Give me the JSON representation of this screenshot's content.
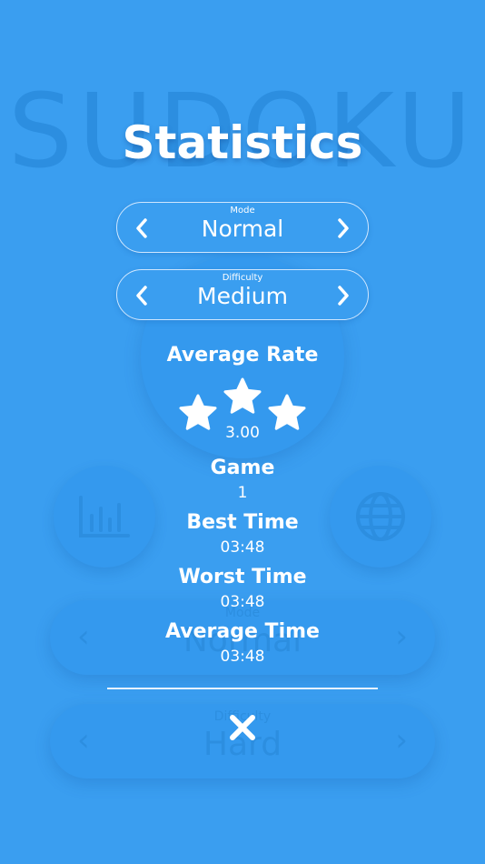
{
  "background": {
    "title": "SUDOKU",
    "mode_caption": "Mode",
    "mode_value": "Normal",
    "difficulty_caption": "Difficulty",
    "difficulty_value": "Hard"
  },
  "statistics": {
    "title": "Statistics",
    "mode": {
      "caption": "Mode",
      "value": "Normal"
    },
    "difficulty": {
      "caption": "Difficulty",
      "value": "Medium"
    },
    "average_rate": {
      "label": "Average Rate",
      "value": "3.00",
      "stars": 3
    },
    "game": {
      "label": "Game",
      "value": "1"
    },
    "best_time": {
      "label": "Best Time",
      "value": "03:48"
    },
    "worst_time": {
      "label": "Worst Time",
      "value": "03:48"
    },
    "average_time": {
      "label": "Average Time",
      "value": "03:48"
    }
  },
  "colors": {
    "background": "#3a9ef0",
    "text": "#ffffff",
    "dimmed": "#2c8ee0"
  },
  "icons": [
    "chevron-left-icon",
    "chevron-right-icon",
    "star-icon",
    "close-icon",
    "play-icon",
    "bar-chart-icon",
    "globe-icon"
  ]
}
